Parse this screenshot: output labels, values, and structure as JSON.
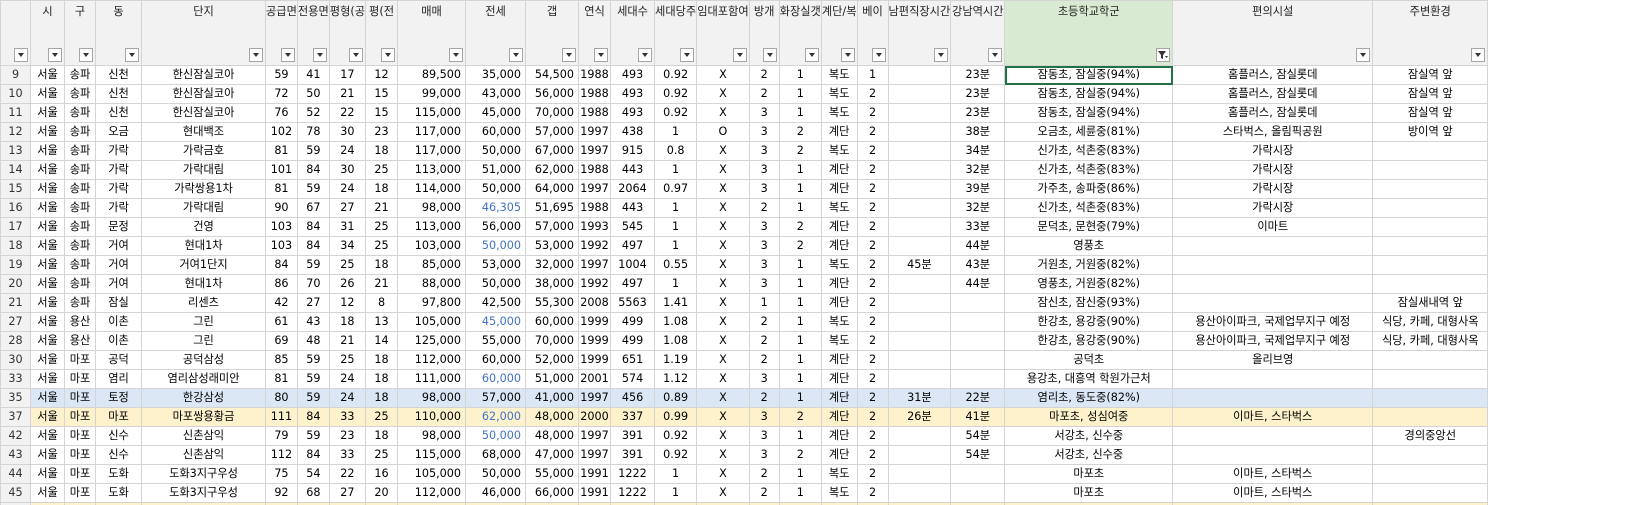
{
  "headers": [
    {
      "label": "",
      "filter": "arrow"
    },
    {
      "label": "시",
      "filter": "arrow"
    },
    {
      "label": "구",
      "filter": "arrow"
    },
    {
      "label": "동",
      "filter": "arrow"
    },
    {
      "label": "단지",
      "filter": "arrow"
    },
    {
      "label": "공급면",
      "filter": "arrow"
    },
    {
      "label": "전용면",
      "filter": "arrow"
    },
    {
      "label": "평형(공",
      "filter": "arrow"
    },
    {
      "label": "평(전",
      "filter": "arrow"
    },
    {
      "label": "매매",
      "filter": "arrow"
    },
    {
      "label": "전세",
      "filter": "arrow"
    },
    {
      "label": "갭",
      "filter": "arrow"
    },
    {
      "label": "연식",
      "filter": "arrow"
    },
    {
      "label": "세대수",
      "filter": "arrow"
    },
    {
      "label": "세대당주",
      "filter": "arrow"
    },
    {
      "label": "임대포함여",
      "filter": "arrow"
    },
    {
      "label": "방개",
      "filter": "arrow"
    },
    {
      "label": "화장실갯",
      "filter": "arrow"
    },
    {
      "label": "계단/복",
      "filter": "arrow"
    },
    {
      "label": "베이",
      "filter": "arrow"
    },
    {
      "label": "남편직장시간",
      "filter": "arrow"
    },
    {
      "label": "강남역시간",
      "filter": "arrow"
    },
    {
      "label": "초등학교학군",
      "filter": "funnel"
    },
    {
      "label": "편의시설",
      "filter": "arrow"
    },
    {
      "label": "주변환경",
      "filter": "arrow"
    }
  ],
  "rows": [
    {
      "style": "",
      "cells": [
        "9",
        "서울",
        "송파",
        "신천",
        "한신잠실코아",
        "59",
        "41",
        "17",
        "12",
        "89,500",
        "35,000",
        "54,500",
        "1988",
        "493",
        "0.92",
        "X",
        "2",
        "1",
        "복도",
        "1",
        "",
        "23분",
        "잠동초, 잠실중(94%)",
        "홈플러스, 잠실롯데",
        "잠실역 앞"
      ]
    },
    {
      "style": "",
      "cells": [
        "10",
        "서울",
        "송파",
        "신천",
        "한신잠실코아",
        "72",
        "50",
        "21",
        "15",
        "99,000",
        "43,000",
        "56,000",
        "1988",
        "493",
        "0.92",
        "X",
        "2",
        "1",
        "복도",
        "2",
        "",
        "23분",
        "잠동초, 잠실중(94%)",
        "홈플러스, 잠실롯데",
        "잠실역 앞"
      ]
    },
    {
      "style": "",
      "cells": [
        "11",
        "서울",
        "송파",
        "신천",
        "한신잠실코아",
        "76",
        "52",
        "22",
        "15",
        "115,000",
        "45,000",
        "70,000",
        "1988",
        "493",
        "0.92",
        "X",
        "3",
        "1",
        "복도",
        "2",
        "",
        "23분",
        "잠동초, 잠실중(94%)",
        "홈플러스, 잠실롯데",
        "잠실역 앞"
      ]
    },
    {
      "style": "",
      "cells": [
        "12",
        "서울",
        "송파",
        "오금",
        "현대백조",
        "102",
        "78",
        "30",
        "23",
        "117,000",
        "60,000",
        "57,000",
        "1997",
        "438",
        "1",
        "O",
        "3",
        "2",
        "계단",
        "2",
        "",
        "38분",
        "오금초, 세륜중(81%)",
        "스타벅스, 올림픽공원",
        "방이역 앞"
      ]
    },
    {
      "style": "",
      "cells": [
        "13",
        "서울",
        "송파",
        "가락",
        "가락금호",
        "81",
        "59",
        "24",
        "18",
        "117,000",
        "50,000",
        "67,000",
        "1997",
        "915",
        "0.8",
        "X",
        "3",
        "2",
        "복도",
        "2",
        "",
        "34분",
        "신가초, 석촌중(83%)",
        "가락시장",
        ""
      ]
    },
    {
      "style": "",
      "cells": [
        "14",
        "서울",
        "송파",
        "가락",
        "가락대림",
        "101",
        "84",
        "30",
        "25",
        "113,000",
        "51,000",
        "62,000",
        "1988",
        "443",
        "1",
        "X",
        "3",
        "1",
        "계단",
        "2",
        "",
        "32분",
        "신가초, 석촌중(83%)",
        "가락시장",
        ""
      ]
    },
    {
      "style": "",
      "cells": [
        "15",
        "서울",
        "송파",
        "가락",
        "가락쌍용1차",
        "81",
        "59",
        "24",
        "18",
        "114,000",
        "50,000",
        "64,000",
        "1997",
        "2064",
        "0.97",
        "X",
        "3",
        "1",
        "계단",
        "2",
        "",
        "39분",
        "가주초, 송파중(86%)",
        "가락시장",
        ""
      ]
    },
    {
      "style": "",
      "cells": [
        "16",
        "서울",
        "송파",
        "가락",
        "가락대림",
        "90",
        "67",
        "27",
        "21",
        "98,000",
        "46,305",
        "51,695",
        "1988",
        "443",
        "1",
        "X",
        "2",
        "1",
        "복도",
        "2",
        "",
        "32분",
        "신가초, 석촌중(83%)",
        "가락시장",
        ""
      ]
    },
    {
      "style": "",
      "cells": [
        "17",
        "서울",
        "송파",
        "문정",
        "건영",
        "103",
        "84",
        "31",
        "25",
        "113,000",
        "56,000",
        "57,000",
        "1993",
        "545",
        "1",
        "X",
        "3",
        "2",
        "계단",
        "2",
        "",
        "33분",
        "문덕초, 문현중(79%)",
        "이마트",
        ""
      ]
    },
    {
      "style": "",
      "cells": [
        "18",
        "서울",
        "송파",
        "거여",
        "현대1차",
        "103",
        "84",
        "34",
        "25",
        "103,000",
        "50,000",
        "53,000",
        "1992",
        "497",
        "1",
        "X",
        "3",
        "2",
        "계단",
        "2",
        "",
        "44분",
        "영풍초",
        "",
        ""
      ]
    },
    {
      "style": "",
      "cells": [
        "19",
        "서울",
        "송파",
        "거여",
        "거여1단지",
        "84",
        "59",
        "25",
        "18",
        "85,000",
        "53,000",
        "32,000",
        "1997",
        "1004",
        "0.55",
        "X",
        "3",
        "1",
        "복도",
        "2",
        "45분",
        "43분",
        "거원초, 거원중(82%)",
        "",
        ""
      ]
    },
    {
      "style": "",
      "cells": [
        "20",
        "서울",
        "송파",
        "거여",
        "현대1차",
        "86",
        "70",
        "26",
        "21",
        "88,000",
        "50,000",
        "38,000",
        "1992",
        "497",
        "1",
        "X",
        "3",
        "1",
        "계단",
        "2",
        "",
        "44분",
        "영풍초, 거원중(82%)",
        "",
        ""
      ]
    },
    {
      "style": "",
      "cells": [
        "21",
        "서울",
        "송파",
        "잠실",
        "리센츠",
        "42",
        "27",
        "12",
        "8",
        "97,800",
        "42,500",
        "55,300",
        "2008",
        "5563",
        "1.41",
        "X",
        "1",
        "1",
        "계단",
        "2",
        "",
        "",
        "잠신초, 잠신중(93%)",
        "",
        "잠실새내역 앞"
      ]
    },
    {
      "style": "",
      "cells": [
        "27",
        "서울",
        "용산",
        "이촌",
        "그린",
        "61",
        "43",
        "18",
        "13",
        "105,000",
        "45,000",
        "60,000",
        "1999",
        "499",
        "1.08",
        "X",
        "2",
        "1",
        "복도",
        "2",
        "",
        "",
        "한강초, 용강중(90%)",
        "용산아이파크, 국제업무지구 예정",
        "식당, 카페, 대형사옥"
      ]
    },
    {
      "style": "",
      "cells": [
        "28",
        "서울",
        "용산",
        "이촌",
        "그린",
        "69",
        "48",
        "21",
        "14",
        "125,000",
        "55,000",
        "70,000",
        "1999",
        "499",
        "1.08",
        "X",
        "2",
        "1",
        "복도",
        "2",
        "",
        "",
        "한강초, 용강중(90%)",
        "용산아이파크, 국제업무지구 예정",
        "식당, 카페, 대형사옥"
      ]
    },
    {
      "style": "",
      "cells": [
        "30",
        "서울",
        "마포",
        "공덕",
        "공덕삼성",
        "85",
        "59",
        "25",
        "18",
        "112,000",
        "60,000",
        "52,000",
        "1999",
        "651",
        "1.19",
        "X",
        "2",
        "1",
        "계단",
        "2",
        "",
        "",
        "공덕초",
        "올리브영",
        ""
      ]
    },
    {
      "style": "",
      "cells": [
        "33",
        "서울",
        "마포",
        "염리",
        "염리삼성래미안",
        "81",
        "59",
        "24",
        "18",
        "111,000",
        "60,000",
        "51,000",
        "2001",
        "574",
        "1.12",
        "X",
        "3",
        "1",
        "계단",
        "2",
        "",
        "",
        "용강초, 대흥역 학원가근처",
        "",
        ""
      ]
    },
    {
      "style": "blue",
      "cells": [
        "35",
        "서울",
        "마포",
        "토정",
        "한강삼성",
        "80",
        "59",
        "24",
        "18",
        "98,000",
        "57,000",
        "41,000",
        "1997",
        "456",
        "0.89",
        "X",
        "2",
        "1",
        "계단",
        "2",
        "31분",
        "22분",
        "염리초, 동도중(82%)",
        "",
        ""
      ]
    },
    {
      "style": "yellow",
      "cells": [
        "37",
        "서울",
        "마포",
        "마포",
        "마포쌍용황금",
        "111",
        "84",
        "33",
        "25",
        "110,000",
        "62,000",
        "48,000",
        "2000",
        "337",
        "0.99",
        "X",
        "3",
        "2",
        "계단",
        "2",
        "26분",
        "41분",
        "마포초, 성심여중",
        "이마트, 스타벅스",
        ""
      ]
    },
    {
      "style": "",
      "cells": [
        "42",
        "서울",
        "마포",
        "신수",
        "신촌삼익",
        "79",
        "59",
        "23",
        "18",
        "98,000",
        "50,000",
        "48,000",
        "1997",
        "391",
        "0.92",
        "X",
        "3",
        "1",
        "계단",
        "2",
        "",
        "54분",
        "서강초, 신수중",
        "",
        "경의중앙선"
      ]
    },
    {
      "style": "",
      "cells": [
        "43",
        "서울",
        "마포",
        "신수",
        "신촌삼익",
        "112",
        "84",
        "33",
        "25",
        "115,000",
        "68,000",
        "47,000",
        "1997",
        "391",
        "0.92",
        "X",
        "3",
        "2",
        "계단",
        "2",
        "",
        "54분",
        "서강초, 신수중",
        "",
        ""
      ]
    },
    {
      "style": "",
      "cells": [
        "44",
        "서울",
        "마포",
        "도화",
        "도화3지구우성",
        "75",
        "54",
        "22",
        "16",
        "105,000",
        "50,000",
        "55,000",
        "1991",
        "1222",
        "1",
        "X",
        "2",
        "1",
        "복도",
        "2",
        "",
        "",
        "마포초",
        "이마트, 스타벅스",
        ""
      ]
    },
    {
      "style": "",
      "cells": [
        "45",
        "서울",
        "마포",
        "도화",
        "도화3지구우성",
        "92",
        "68",
        "27",
        "20",
        "112,000",
        "46,000",
        "66,000",
        "1991",
        "1222",
        "1",
        "X",
        "2",
        "1",
        "복도",
        "2",
        "",
        "",
        "마포초",
        "이마트, 스타벅스",
        ""
      ]
    }
  ],
  "link_cells": [
    {
      "row": 7,
      "col": 10
    },
    {
      "row": 9,
      "col": 10
    },
    {
      "row": 13,
      "col": 10
    },
    {
      "row": 16,
      "col": 10
    },
    {
      "row": 18,
      "col": 10
    },
    {
      "row": 19,
      "col": 10
    }
  ],
  "selected_cell": {
    "row": 0,
    "col": 22
  }
}
